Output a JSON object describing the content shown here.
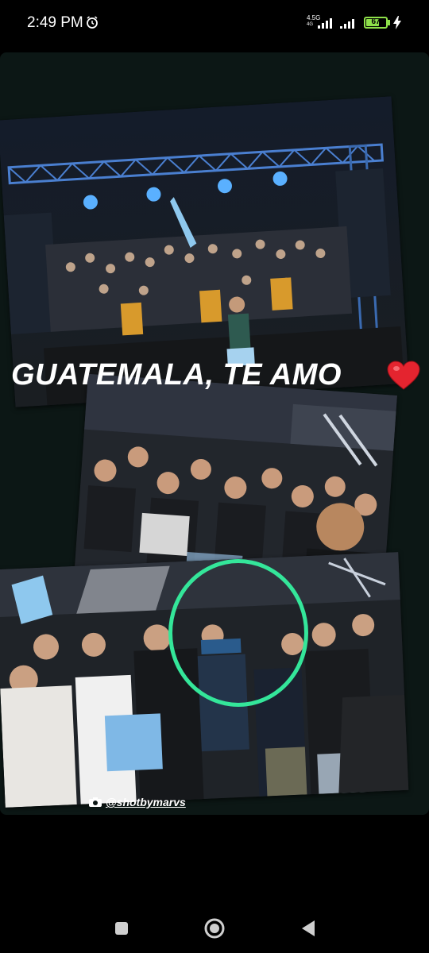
{
  "status_bar": {
    "time": "2:49 PM",
    "network_type": "4.5G",
    "network_sub": "4G",
    "battery_level": "67",
    "battery_fraction": 0.67,
    "alarm_icon": "alarm-clock-icon",
    "charging_icon": "charging-bolt-icon"
  },
  "story": {
    "headline": "GUATEMALA, TE AMO",
    "headline_emoji_icon": "red-heart-icon",
    "credit_icon": "camera-icon",
    "credit": "@shotbymarvs",
    "highlight_color": "#34e69a",
    "photos": [
      {
        "name": "concert-stage-photo",
        "description_icon": "photo"
      },
      {
        "name": "crowd-selfie-photo",
        "description_icon": "photo"
      },
      {
        "name": "crowd-meet-photo",
        "description_icon": "photo"
      }
    ]
  },
  "nav": {
    "recents_icon": "square-recents-icon",
    "home_icon": "circle-home-icon",
    "back_icon": "triangle-back-icon"
  }
}
